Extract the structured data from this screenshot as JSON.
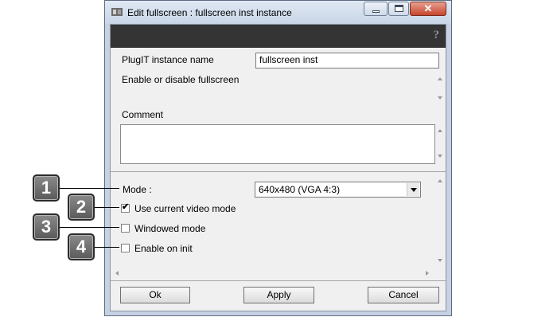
{
  "window": {
    "title": "Edit fullscreen : fullscreen inst instance",
    "close_glyph": "✕"
  },
  "toolbar": {
    "help_glyph": "?"
  },
  "form": {
    "instance_name_label": "PlugIT instance name",
    "instance_name_value": "fullscreen inst",
    "description": "Enable or disable fullscreen",
    "comment_label": "Comment",
    "mode_label": "Mode :",
    "mode_value": "640x480 (VGA 4:3)",
    "use_current_label": "Use current video mode",
    "use_current_checked": true,
    "windowed_label": "Windowed mode",
    "windowed_checked": false,
    "enable_on_init_label": "Enable on init",
    "enable_on_init_checked": false,
    "check_glyph": "✔"
  },
  "buttons": {
    "ok": "Ok",
    "apply": "Apply",
    "cancel": "Cancel"
  },
  "callouts": [
    "1",
    "2",
    "3",
    "4"
  ],
  "icons": {
    "app": "app-icon",
    "minimize": "minimize-icon",
    "maximize": "maximize-icon",
    "close": "close-icon",
    "help": "help-icon",
    "dropdown": "chevron-down-icon"
  }
}
